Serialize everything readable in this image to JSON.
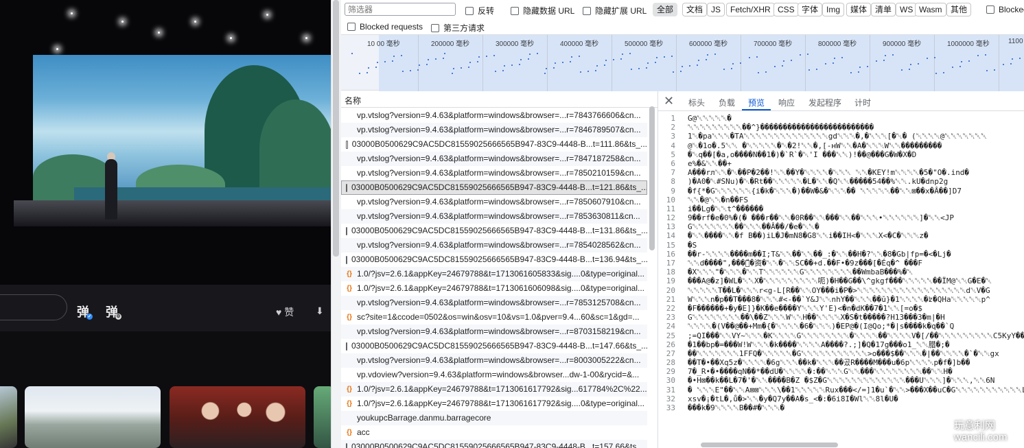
{
  "video_page": {
    "danmu_button_1": "弹",
    "danmu_button_2": "弹",
    "like_label": "赞"
  },
  "toolbar": {
    "filter_placeholder": "筛选器",
    "invert_label": "反转",
    "hide_data_urls_label": "隐藏数据 URL",
    "hide_ext_urls_label": "隐藏扩展 URL",
    "type_chips": [
      "全部",
      "文档",
      "JS",
      "Fetch/XHR",
      "CSS",
      "字体",
      "Img",
      "媒体",
      "清单",
      "WS",
      "Wasm",
      "其他"
    ],
    "active_chip": "全部",
    "blocked_cookies_label": "Blocked",
    "blocked_requests_label": "Blocked requests",
    "third_party_label": "第三方请求"
  },
  "overview": {
    "ticks": [
      "10 00 毫秒",
      "200000 毫秒",
      "300000 毫秒",
      "400000 毫秒",
      "500000 毫秒",
      "600000 毫秒",
      "700000 毫秒",
      "800000 毫秒",
      "900000 毫秒",
      "1000000 毫秒",
      "1100"
    ]
  },
  "request_list": {
    "header": "名称",
    "rows": [
      {
        "icon": "blank",
        "name": "vp.vtslog?version=9.4.63&platform=windows&browser=...r=7843766606&cn..."
      },
      {
        "icon": "blank",
        "name": "vp.vtslog?version=9.4.63&platform=windows&browser=...r=7846789507&cn..."
      },
      {
        "icon": "doc",
        "name": "03000B0500629C9AC5DC81559025666565B947-83C9-4448-B...t=111.86&ts_..."
      },
      {
        "icon": "blank",
        "name": "vp.vtslog?version=9.4.63&platform=windows&browser=...r=7847187258&cn..."
      },
      {
        "icon": "blank",
        "name": "vp.vtslog?version=9.4.63&platform=windows&browser=...r=7850210159&cn..."
      },
      {
        "icon": "doc",
        "name": "03000B0500629C9AC5DC81559025666565B947-83C9-4448-B...t=121.86&ts_...",
        "selected": true
      },
      {
        "icon": "blank",
        "name": "vp.vtslog?version=9.4.63&platform=windows&browser=...r=7850607910&cn..."
      },
      {
        "icon": "blank",
        "name": "vp.vtslog?version=9.4.63&platform=windows&browser=...r=7853630811&cn..."
      },
      {
        "icon": "doc",
        "name": "03000B0500629C9AC5DC81559025666565B947-83C9-4448-B...t=131.86&ts_..."
      },
      {
        "icon": "blank",
        "name": "vp.vtslog?version=9.4.63&platform=windows&browser=...r=7854028562&cn..."
      },
      {
        "icon": "doc",
        "name": "03000B0500629C9AC5DC81559025666565B947-83C9-4448-B...t=136.94&ts_..."
      },
      {
        "icon": "js",
        "name": "1.0/?jsv=2.6.1&appKey=24679788&t=1713061605833&sig....0&type=original..."
      },
      {
        "icon": "js",
        "name": "1.0/?jsv=2.6.1&appKey=24679788&t=1713061606098&sig....0&type=original..."
      },
      {
        "icon": "blank",
        "name": "vp.vtslog?version=9.4.63&platform=windows&browser=...r=7853125708&cn..."
      },
      {
        "icon": "js",
        "name": "sc?site=1&ccode=0502&os=win&osv=10&vs=1.0&pver=9.4...60&sc=1&gd=..."
      },
      {
        "icon": "blank",
        "name": "vp.vtslog?version=9.4.63&platform=windows&browser=...r=8703158219&cn..."
      },
      {
        "icon": "doc",
        "name": "03000B0500629C9AC5DC81559025666565B947-83C9-4448-B...t=147.66&ts_..."
      },
      {
        "icon": "blank",
        "name": "vp.vtslog?version=9.4.63&platform=windows&browser=...r=8003005222&cn..."
      },
      {
        "icon": "blank",
        "name": "vp.vdoview?version=9.4.63&platform=windows&browser...dw-1-00&rycid=&..."
      },
      {
        "icon": "js",
        "name": "1.0/?jsv=2.6.1&appKey=24679788&t=1713061617792&sig...617784%2C%22..."
      },
      {
        "icon": "js",
        "name": "1.0/?jsv=2.6.1&appKey=24679788&t=1713061617792&sig....0&type=original..."
      },
      {
        "icon": "blank",
        "name": "youkupcBarrage.danmu.barragecore"
      },
      {
        "icon": "js",
        "name": "acc"
      },
      {
        "icon": "doc",
        "name": "03000B0500629C9AC5DC81559025666565B947-83C9-4448-B...t=157.66&ts_..."
      }
    ]
  },
  "detail": {
    "tabs": [
      "标头",
      "负载",
      "预览",
      "响应",
      "发起程序",
      "计时"
    ],
    "active_tab": "预览",
    "lines": [
      "G@␀␀␀␀␀�",
      "␀␀␀␀␀␀␀␀␀��^}�������������������������",
      "1␀�pa␀␀␀�TA␀␀␀␀␀␀␀␀␀␀␀␀␀␀gd␀␀␀�,�␀␀␀[�␀�  (␀␀␀␀@␀␀␀␀␀␀␀",
      "@␀�1o�.5␀␀   �␀␀␀␀␀�␀�2!␀␀�,[-ʜW␀␀�A�␀␀␀W␀␀���������",
      "�␀q��[�a,o����N��1�)�`R`�␀'I ���␀␀)!��@���G�W�X�D",
      "e%�&␀␀��+",
      "A���rл␀␀�␀��P�2��!␀␀��Y�␀␀␀␀�␀␀␀  ␀␀�KEY!m␀␀␀␀�5�\"O�.ind�",
      ")�A0�␀#SNu)�␀�Rt��␀␀␀␀␀�L�␀␀�Q␀␀�����54��%␀␀.kU�dnp2g",
      "�f{*�G␀␀␀␀␀␀{i�k�␀␀␀�)��W�&�␀␀␀��    ␀␀␀␀␀��␀␀⊠��x�Â��]D7",
      "␀␀�@␀␀�n��FS",
      "i��Lg�␀␀t^������",
      "9��rf�e�0%�(�   ���r��␀␀�0R��␀␀���␀␀��␀␀␀•␀␀␀␀␀␀]�␀␀<JP",
      "G␀␀␀␀␀␀␀��␀␀␀��Â��/�e�␀␀�",
      "�␀␀����␀␀�f   B��)iL�J�mN8�G8␀␀i��IH<�␀␀␀X<�C�␀␀␀z�",
      "�S",
      "��r-␀␀␀␀����m��I;T&␀␀��␀␀��_:�␀␀��H�?␀␀�8�Gb|fp=�<�Lj�",
      "␀␀d����\",���␀ّ�资�␀␀�␀␀SC��+d.��F•�9z���[�Éq�^   ���F",
      "�X␀␀␀\"�␀␀␀�␀␀T␀␀␀␀␀␀G␀␀␀␀␀␀␀␀��WmbaB���%�␀",
      "���A@�z]�WL�␀␀X�␀␀␀␀␀␀␀␀␀呃)�H��G��\\^gkgf���␀␀␀␀␀��ÏM@␀␀G�E�␀",
      "␀␀␀␀␀T��L�␀␀␀r<g-L[R��␀␀OY���i�P�>␀␀␀␀␀␀␀␀␀␀␀␀␀␀␀␀␀␀d␀V�G",
      "W␀␀␀n�p��T���8�␀␀␀#<-��`Y&J␀␀nhY��␀␀␀��ŭ}�1␀␀␀␀�ʫ�QHa␀␀␀␀␀p^",
      "�F������+�y�E]}�K��e����Y␀␀␀Y'E)<�n�dK��7�1␀␀[=o�$",
      "G␀␀␀␀␀␀␀␀��\\��Z␀␀␀W␀␀H��␀␀␀␀X�S�t�����?H13���3�m|�H",
      "␀␀␀␀�(V��@��+Mm�{�␀␀␀␀�6�␀␀␀)�EP@�(I@Qo;*�|s����k�q��`Q",
      ";=QI���␀␀VY~␀␀␀�K␀␀␀␀G␀␀␀␀␀␀␀␀�␀␀␀␀��␀␀␀␀V�[/��␀␀␀␀␀␀␀␀␀C5KyY��GU%��␀␀␀�0",
      "�1��bp�=���W!W␀␀␀�k����␀␀␀␀A����?.;]�Q�17g���o1_␀␀腊�;�",
      "��␀␀␀␀␀␀␀1FFQ�␀␀␀␀␀�G␀␀␀␀␀␀␀␀␀␀␀>o���$��␀␀␀�|��␀␀␀␀�`�␀␀gx",
      "��T�•��Xq5z�␀␀␀␀�6g␀␀␀��k�␀␀␀��곴R����M���u�6p␀␀␀␀p�f�]b��",
      "7�_R•�•����qN��*��dU�␀␀␀␀�:��␀␀␀G␀␀���␀␀␀␀␀␀␀␀��␀␀H�",
      "�•H⊠��k��L�7�'�␀␀����B�Z �$Z�G␀␀␀␀␀␀␀␀␀␀␀␀␀���U␀␀␀]�␀␀␀,␀␀6N",
      "�  ␀␀␀E\"��␀␀A⊠⊠␀␀␀\\��1␀␀␀␀␀Rux���</=]1�u`�␀␀>���X��uC�G␀␀␀␀␀␀␀␀␀␀␀L�",
      "xsv�¡�tL�,ů�>␀␀�y�Q7y��A�s_<�:�6i8I�Wl␀␀8l�U�",
      "���k�9␀␀␀␀B��#�␀␀␀�"
    ]
  },
  "watermark": {
    "line1": "玩意利网",
    "line2": "wancili.com"
  },
  "colors": {
    "accent": "#0b57d0",
    "selected_row": "#e3e3e3",
    "overview_select": "#d7e4f8",
    "js_icon": "#e8710a",
    "code_marker": "#c5221f"
  }
}
